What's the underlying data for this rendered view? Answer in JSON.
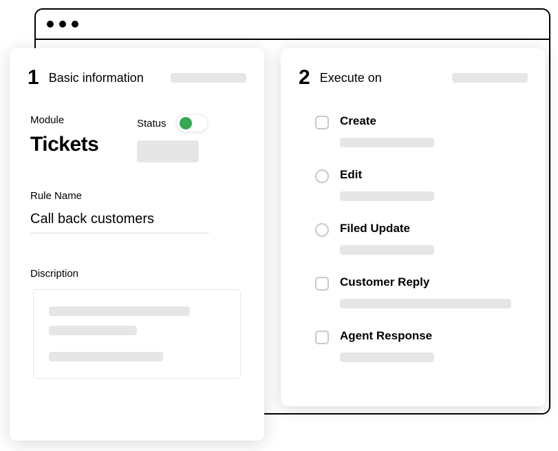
{
  "panels": {
    "basic": {
      "number": "1",
      "title": "Basic information",
      "module_label": "Module",
      "module_value": "Tickets",
      "status_label": "Status",
      "status_on": true,
      "rule_name_label": "Rule Name",
      "rule_name_value": "Call back customers",
      "description_label": "Discription"
    },
    "execute": {
      "number": "2",
      "title": "Execute on",
      "options": [
        {
          "label": "Create",
          "shape": "square",
          "skel": "sm"
        },
        {
          "label": "Edit",
          "shape": "round",
          "skel": "sm"
        },
        {
          "label": "Filed Update",
          "shape": "round",
          "skel": "sm"
        },
        {
          "label": "Customer Reply",
          "shape": "square",
          "skel": "lg"
        },
        {
          "label": "Agent Response",
          "shape": "square",
          "skel": "sm"
        }
      ]
    }
  }
}
